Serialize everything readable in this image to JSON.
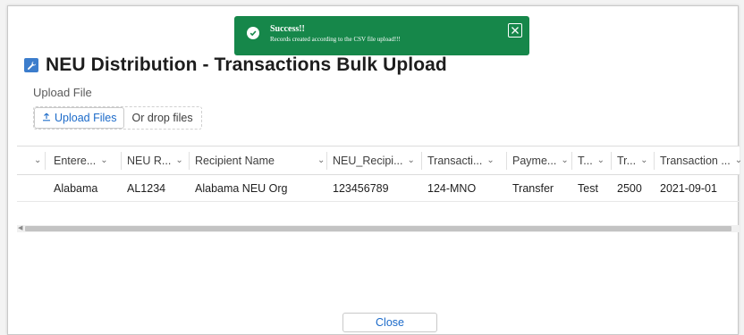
{
  "page": {
    "title": "NEU Distribution - Transactions Bulk Upload",
    "upload_label": "Upload File",
    "upload_button": "Upload Files",
    "drop_text": "Or drop files",
    "close_button": "Close"
  },
  "toast": {
    "title": "Success!!",
    "message": "Records created according to the CSV file upload!!!",
    "color": "#16874a"
  },
  "table": {
    "columns": [
      "Entere...",
      "NEU R...",
      "Recipient Name",
      "NEU_Recipi...",
      "Transacti...",
      "Payme...",
      "T...",
      "Tr...",
      "Transaction ..."
    ],
    "rows": [
      [
        "Alabama",
        "AL1234",
        "Alabama NEU Org",
        "123456789",
        "124-MNO",
        "Transfer",
        "Test",
        "2500",
        "2021-09-01"
      ]
    ]
  },
  "icons": {
    "header": "wrench-icon",
    "upload": "upload-icon",
    "toast_status": "check-circle-icon",
    "toast_close": "close-icon",
    "column_menu": "chevron-down-icon"
  },
  "colors": {
    "accent": "#1b6ac9",
    "header_icon": "#3c7dcc"
  }
}
